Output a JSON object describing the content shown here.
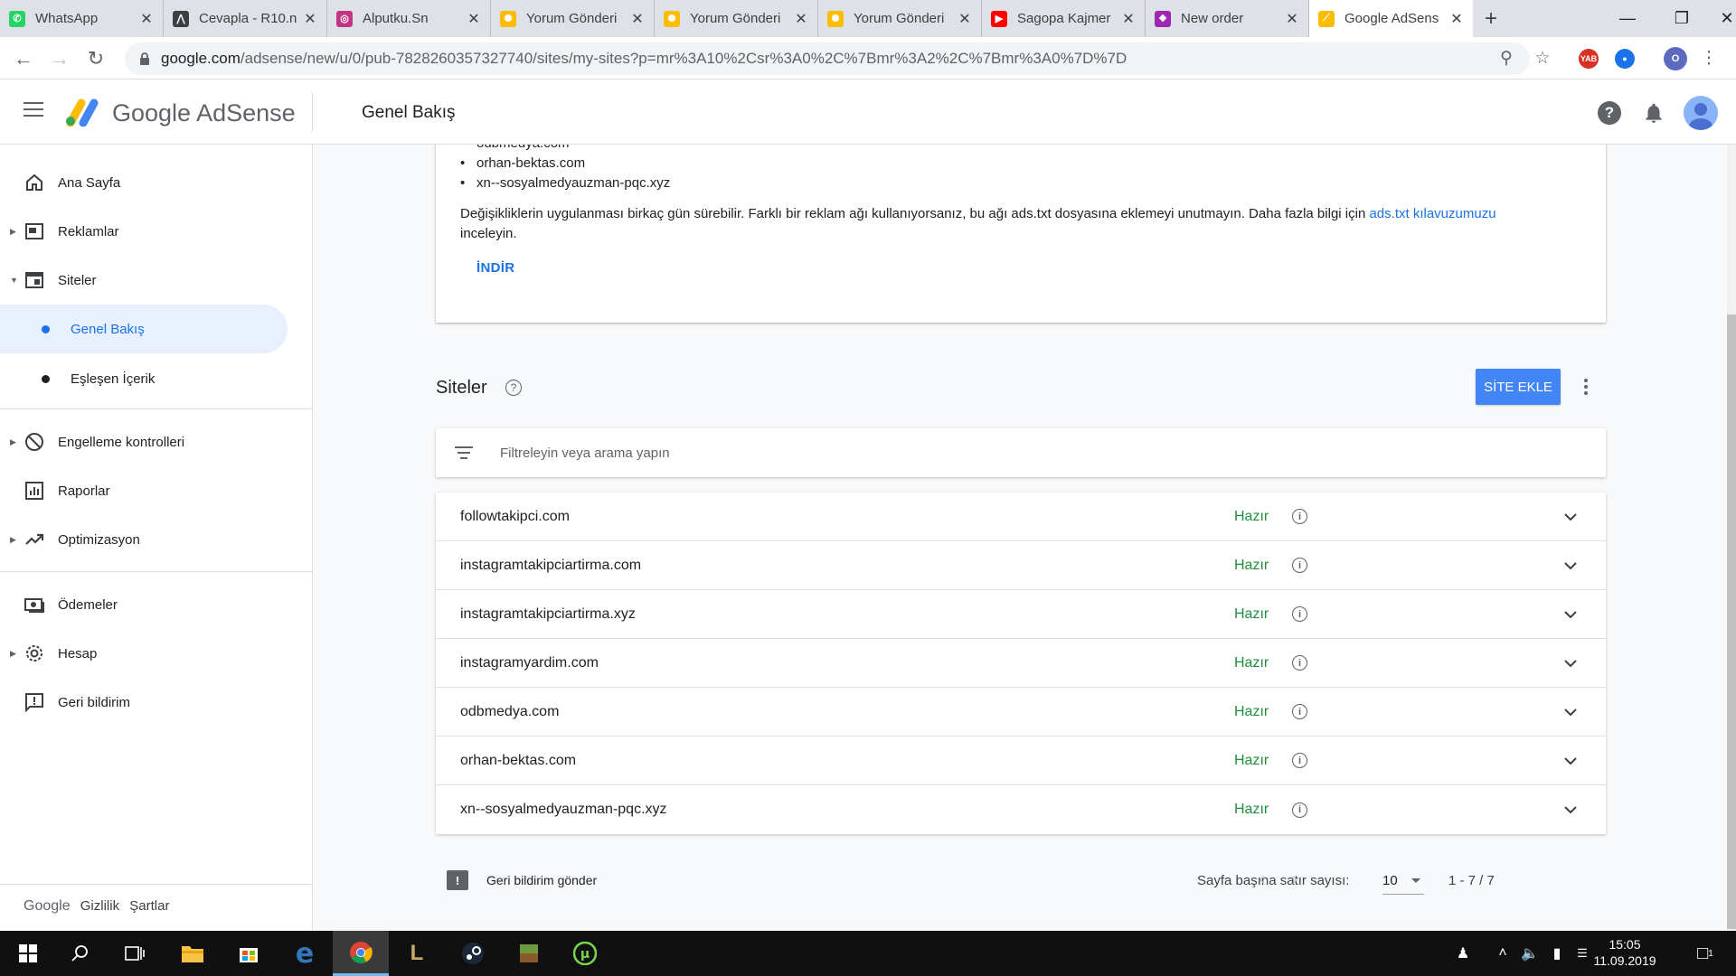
{
  "browser": {
    "tabs": [
      {
        "title": "WhatsApp",
        "icon": "whatsapp-icon",
        "color": "#25d366",
        "active": false
      },
      {
        "title": "Cevapla - R10.n",
        "icon": "r10-icon",
        "color": "#3c4043",
        "active": false
      },
      {
        "title": "Alputku.Sn",
        "icon": "instagram-icon",
        "color": "#c13584",
        "active": false
      },
      {
        "title": "Yorum Gönderi",
        "icon": "google-photos-icon",
        "color": "#fbbc04",
        "active": false
      },
      {
        "title": "Yorum Gönderi",
        "icon": "google-photos-icon",
        "color": "#fbbc04",
        "active": false
      },
      {
        "title": "Yorum Gönderi",
        "icon": "google-photos-icon",
        "color": "#fbbc04",
        "active": false
      },
      {
        "title": "Sagopa Kajmer",
        "icon": "youtube-icon",
        "color": "#ff0000",
        "active": false
      },
      {
        "title": "New order",
        "icon": "order-icon",
        "color": "#9c27b0",
        "active": false
      },
      {
        "title": "Google AdSens",
        "icon": "adsense-icon",
        "color": "#fbbc04",
        "active": true
      }
    ],
    "url_host": "google.com",
    "url_path": "/adsense/new/u/0/pub-7828260357327740/sites/my-sites?p=mr%3A10%2Csr%3A0%2C%7Bmr%3A2%2C%7Bmr%3A0%7D%7D",
    "profile_initial": "O"
  },
  "header": {
    "brand_google": "Google",
    "brand_product": "AdSense",
    "page_title": "Genel Bakış"
  },
  "sidebar": {
    "items": [
      {
        "label": "Ana Sayfa",
        "icon": "home-icon"
      },
      {
        "label": "Reklamlar",
        "icon": "ads-icon"
      },
      {
        "label": "Siteler",
        "icon": "sites-icon"
      },
      {
        "label": "Genel Bakış",
        "icon": "dot"
      },
      {
        "label": "Eşleşen İçerik",
        "icon": "dot"
      },
      {
        "label": "Engelleme kontrolleri",
        "icon": "block-icon"
      },
      {
        "label": "Raporlar",
        "icon": "reports-icon"
      },
      {
        "label": "Optimizasyon",
        "icon": "trending-icon"
      },
      {
        "label": "Ödemeler",
        "icon": "payments-icon"
      },
      {
        "label": "Hesap",
        "icon": "gear-icon"
      },
      {
        "label": "Geri bildirim",
        "icon": "feedback-icon"
      }
    ],
    "footer": {
      "google": "Google",
      "privacy": "Gizlilik",
      "terms": "Şartlar"
    }
  },
  "ads_txt_card": {
    "domains": [
      "odbmedya.com",
      "orhan-bektas.com",
      "xn--sosyalmedyauzman-pqc.xyz"
    ],
    "note_text": "Değişikliklerin uygulanması birkaç gün sürebilir. Farklı bir reklam ağı kullanıyorsanız, bu ağı ads.txt dosyasına eklemeyi unutmayın. Daha fazla bilgi için",
    "note_link": "ads.txt kılavuzumuzu",
    "note_tail": "inceleyin.",
    "download_label": "İNDİR"
  },
  "sites": {
    "title": "Siteler",
    "add_button": "SİTE EKLE",
    "filter_placeholder": "Filtreleyin veya arama yapın",
    "rows": [
      {
        "domain": "followtakipci.com",
        "status": "Hazır"
      },
      {
        "domain": "instagramtakipciartirma.com",
        "status": "Hazır"
      },
      {
        "domain": "instagramtakipciartirma.xyz",
        "status": "Hazır"
      },
      {
        "domain": "instagramyardim.com",
        "status": "Hazır"
      },
      {
        "domain": "odbmedya.com",
        "status": "Hazır"
      },
      {
        "domain": "orhan-bektas.com",
        "status": "Hazır"
      },
      {
        "domain": "xn--sosyalmedyauzman-pqc.xyz",
        "status": "Hazır"
      }
    ],
    "feedback_label": "Geri bildirim gönder",
    "rows_per_page_label": "Sayfa başına satır sayısı:",
    "rows_per_page_value": "10",
    "range_label": "1 - 7 / 7"
  },
  "taskbar": {
    "time": "15:05",
    "date": "11.09.2019",
    "notification_count": "1"
  },
  "colors": {
    "accent": "#1a73e8",
    "status_ready": "#1e8e3e",
    "add_button": "#4285f4"
  }
}
